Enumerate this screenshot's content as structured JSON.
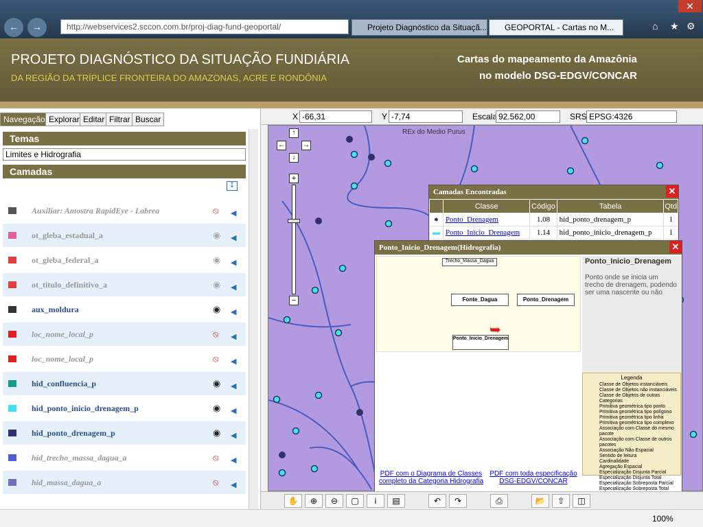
{
  "browser": {
    "address": "http://webservices2.sccon.com.br/proj-diag-fund-geoportal/",
    "tabs": [
      "Projeto Diagnóstico da Situaçã...",
      "GEOPORTAL - Cartas no M..."
    ],
    "zoom": "100%"
  },
  "banner": {
    "title": "PROJETO DIAGNÓSTICO DA SITUAÇÃO FUNDIÁRIA",
    "subtitle": "DA REGIÃO DA TRÍPLICE FRONTEIRA DO AMAZONAS, ACRE E RONDÔNIA",
    "right1": "Cartas do mapeamento da Amazônia",
    "right2": "no modelo DSG-EDGV/CONCAR"
  },
  "left": {
    "tabs": [
      "Navegação",
      "Explorar",
      "Editar",
      "Filtrar",
      "Buscar"
    ],
    "temas_header": "Temas",
    "tema_selected": "Limites e Hidrografia",
    "camadas_header": "Camadas",
    "layers": [
      {
        "name": "Auxiliar: Amostra RapidEye - Labrea",
        "color": "#555",
        "style": "italic-gray",
        "visible": false
      },
      {
        "name": "ot_gleba_estadual_a",
        "color": "#e060a0",
        "style": "gray",
        "visible": "dim"
      },
      {
        "name": "ot_gleba_federal_a",
        "color": "#e04040",
        "style": "gray",
        "visible": "dim"
      },
      {
        "name": "ot_titulo_definitivo_a",
        "color": "#e04040",
        "style": "gray",
        "visible": "dim"
      },
      {
        "name": "aux_moldura",
        "color": "#333",
        "style": "bold",
        "visible": true
      },
      {
        "name": "loc_nome_local_p",
        "color": "#e02020",
        "style": "italic-gray",
        "visible": false
      },
      {
        "name": "loc_nome_local_p",
        "color": "#e02020",
        "style": "italic-gray",
        "visible": false
      },
      {
        "name": "hid_confluencia_p",
        "color": "#1a9a8a",
        "style": "bold",
        "visible": true
      },
      {
        "name": "hid_ponto_inicio_drenagem_p",
        "color": "#40e0f0",
        "style": "bold",
        "visible": true
      },
      {
        "name": "hid_ponto_drenagem_p",
        "color": "#30306a",
        "style": "bold",
        "visible": true
      },
      {
        "name": "hid_trecho_massa_dagua_a",
        "color": "#5060d0",
        "style": "italic-gray",
        "visible": false
      },
      {
        "name": "hid_massa_dagua_a",
        "color": "#7070c0",
        "style": "italic-gray",
        "visible": false
      }
    ]
  },
  "coords": {
    "x_label": "X",
    "x": "-66,31",
    "y_label": "Y",
    "y": "-7,74",
    "scale_label": "Escala",
    "scale": "92.562,00",
    "srs_label": "SRS",
    "srs": "EPSG:4326"
  },
  "map": {
    "label": "REx do Medio Purus"
  },
  "popup1": {
    "title": "Camadas Encontradas",
    "headers": [
      "Classe",
      "Código",
      "Tabela",
      "Qtd"
    ],
    "rows": [
      {
        "classe": "Ponto_Drenagem",
        "codigo": "1.08",
        "tabela": "hid_ponto_drenagem_p",
        "qtd": "1"
      },
      {
        "classe": "Ponto_Inicio_Drenagem",
        "codigo": "1.14",
        "tabela": "hid_ponto_inicio_drenagem_p",
        "qtd": "1"
      }
    ]
  },
  "popup2": {
    "title": "Ponto_Inicio_Drenagem(Hidrografia)",
    "class_name": "Ponto_Inicio_Drenagem",
    "description": "Ponto onde se inicia um trecho de drenagem, podendo ser uma nascente ou não",
    "diagram_labels": [
      "Fonte_Dagua",
      "Ponto_Drenagem",
      "Ponto_Inicio_Drenagem",
      "Trecho_Massa_Dagua"
    ],
    "legend_title": "Legenda",
    "legend": [
      "Classe de Objetos instanciáveis",
      "Classe de Objetos não instanciáveis",
      "Classe de Objetos de outras Categorias",
      "Primitiva geométrica tipo ponto",
      "Primitiva geométrica tipo polígono",
      "Primitiva geométrica tipo linha",
      "Primitiva geométrica tipo complexo",
      "Associação com Classe do mesmo pacote",
      "Associação com Classe de outros pacotes",
      "Associação Não Espacial",
      "Sentido de leitura",
      "Cardinalidade",
      "Agregação Espacial",
      "Especialização Disjunta Parcial",
      "Especialização Disjunta Total",
      "Especialização Sobreposta Parcial",
      "Especialização Sobreposta Total"
    ],
    "pdf1": "PDF com o Diagrama de Classes completo da Categoria Hidrografia",
    "pdf2": "PDF com toda especificação DSG-EDGV/CONCAR"
  }
}
